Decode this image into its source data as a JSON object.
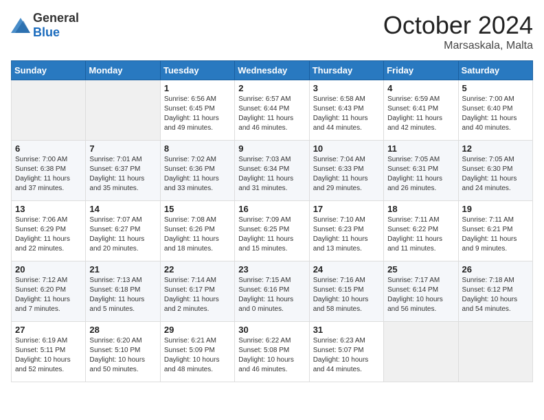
{
  "logo": {
    "general": "General",
    "blue": "Blue"
  },
  "header": {
    "month": "October 2024",
    "location": "Marsaskala, Malta"
  },
  "weekdays": [
    "Sunday",
    "Monday",
    "Tuesday",
    "Wednesday",
    "Thursday",
    "Friday",
    "Saturday"
  ],
  "weeks": [
    [
      {
        "day": "",
        "info": ""
      },
      {
        "day": "",
        "info": ""
      },
      {
        "day": "1",
        "info": "Sunrise: 6:56 AM\nSunset: 6:45 PM\nDaylight: 11 hours and 49 minutes."
      },
      {
        "day": "2",
        "info": "Sunrise: 6:57 AM\nSunset: 6:44 PM\nDaylight: 11 hours and 46 minutes."
      },
      {
        "day": "3",
        "info": "Sunrise: 6:58 AM\nSunset: 6:43 PM\nDaylight: 11 hours and 44 minutes."
      },
      {
        "day": "4",
        "info": "Sunrise: 6:59 AM\nSunset: 6:41 PM\nDaylight: 11 hours and 42 minutes."
      },
      {
        "day": "5",
        "info": "Sunrise: 7:00 AM\nSunset: 6:40 PM\nDaylight: 11 hours and 40 minutes."
      }
    ],
    [
      {
        "day": "6",
        "info": "Sunrise: 7:00 AM\nSunset: 6:38 PM\nDaylight: 11 hours and 37 minutes."
      },
      {
        "day": "7",
        "info": "Sunrise: 7:01 AM\nSunset: 6:37 PM\nDaylight: 11 hours and 35 minutes."
      },
      {
        "day": "8",
        "info": "Sunrise: 7:02 AM\nSunset: 6:36 PM\nDaylight: 11 hours and 33 minutes."
      },
      {
        "day": "9",
        "info": "Sunrise: 7:03 AM\nSunset: 6:34 PM\nDaylight: 11 hours and 31 minutes."
      },
      {
        "day": "10",
        "info": "Sunrise: 7:04 AM\nSunset: 6:33 PM\nDaylight: 11 hours and 29 minutes."
      },
      {
        "day": "11",
        "info": "Sunrise: 7:05 AM\nSunset: 6:31 PM\nDaylight: 11 hours and 26 minutes."
      },
      {
        "day": "12",
        "info": "Sunrise: 7:05 AM\nSunset: 6:30 PM\nDaylight: 11 hours and 24 minutes."
      }
    ],
    [
      {
        "day": "13",
        "info": "Sunrise: 7:06 AM\nSunset: 6:29 PM\nDaylight: 11 hours and 22 minutes."
      },
      {
        "day": "14",
        "info": "Sunrise: 7:07 AM\nSunset: 6:27 PM\nDaylight: 11 hours and 20 minutes."
      },
      {
        "day": "15",
        "info": "Sunrise: 7:08 AM\nSunset: 6:26 PM\nDaylight: 11 hours and 18 minutes."
      },
      {
        "day": "16",
        "info": "Sunrise: 7:09 AM\nSunset: 6:25 PM\nDaylight: 11 hours and 15 minutes."
      },
      {
        "day": "17",
        "info": "Sunrise: 7:10 AM\nSunset: 6:23 PM\nDaylight: 11 hours and 13 minutes."
      },
      {
        "day": "18",
        "info": "Sunrise: 7:11 AM\nSunset: 6:22 PM\nDaylight: 11 hours and 11 minutes."
      },
      {
        "day": "19",
        "info": "Sunrise: 7:11 AM\nSunset: 6:21 PM\nDaylight: 11 hours and 9 minutes."
      }
    ],
    [
      {
        "day": "20",
        "info": "Sunrise: 7:12 AM\nSunset: 6:20 PM\nDaylight: 11 hours and 7 minutes."
      },
      {
        "day": "21",
        "info": "Sunrise: 7:13 AM\nSunset: 6:18 PM\nDaylight: 11 hours and 5 minutes."
      },
      {
        "day": "22",
        "info": "Sunrise: 7:14 AM\nSunset: 6:17 PM\nDaylight: 11 hours and 2 minutes."
      },
      {
        "day": "23",
        "info": "Sunrise: 7:15 AM\nSunset: 6:16 PM\nDaylight: 11 hours and 0 minutes."
      },
      {
        "day": "24",
        "info": "Sunrise: 7:16 AM\nSunset: 6:15 PM\nDaylight: 10 hours and 58 minutes."
      },
      {
        "day": "25",
        "info": "Sunrise: 7:17 AM\nSunset: 6:14 PM\nDaylight: 10 hours and 56 minutes."
      },
      {
        "day": "26",
        "info": "Sunrise: 7:18 AM\nSunset: 6:12 PM\nDaylight: 10 hours and 54 minutes."
      }
    ],
    [
      {
        "day": "27",
        "info": "Sunrise: 6:19 AM\nSunset: 5:11 PM\nDaylight: 10 hours and 52 minutes."
      },
      {
        "day": "28",
        "info": "Sunrise: 6:20 AM\nSunset: 5:10 PM\nDaylight: 10 hours and 50 minutes."
      },
      {
        "day": "29",
        "info": "Sunrise: 6:21 AM\nSunset: 5:09 PM\nDaylight: 10 hours and 48 minutes."
      },
      {
        "day": "30",
        "info": "Sunrise: 6:22 AM\nSunset: 5:08 PM\nDaylight: 10 hours and 46 minutes."
      },
      {
        "day": "31",
        "info": "Sunrise: 6:23 AM\nSunset: 5:07 PM\nDaylight: 10 hours and 44 minutes."
      },
      {
        "day": "",
        "info": ""
      },
      {
        "day": "",
        "info": ""
      }
    ]
  ]
}
